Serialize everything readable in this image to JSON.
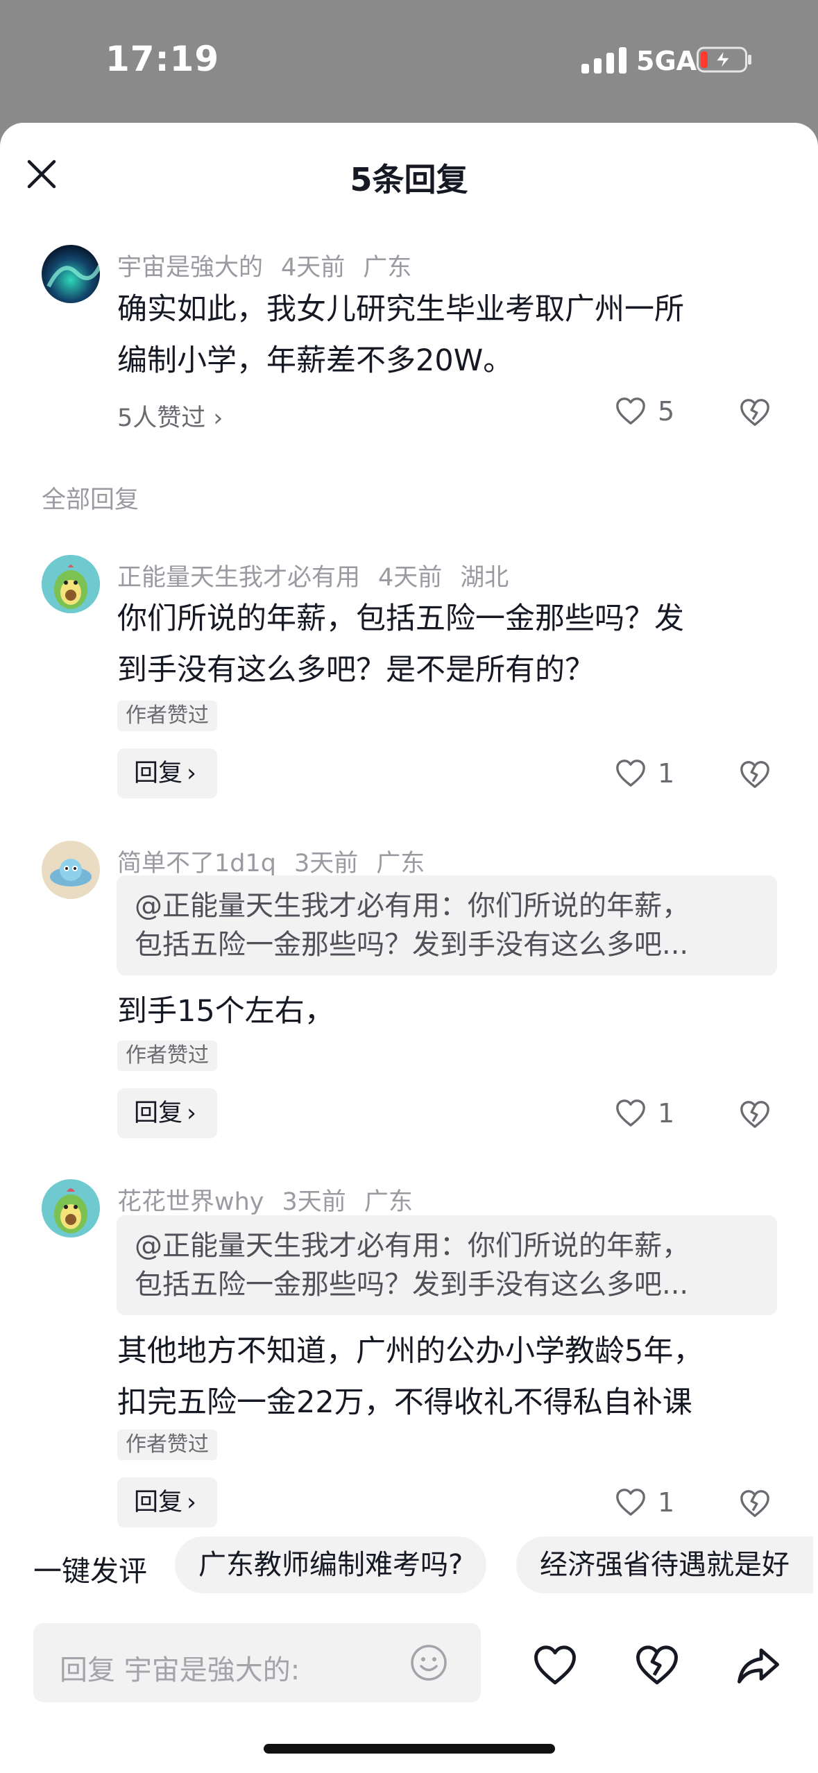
{
  "status_bar": {
    "time": "17:19",
    "network": "5GA"
  },
  "header": {
    "title": "5条回复"
  },
  "main_comment": {
    "author": "宇宙是強大的",
    "time": "4天前",
    "location": "广东",
    "lines": [
      "确实如此，我女儿研究生毕业考取广州一所",
      "编制小学，年薪差不多20W。"
    ],
    "likes_summary": "5人赞过 ›",
    "like_count": "5"
  },
  "section_label": "全部回复",
  "replies": [
    {
      "author": "正能量天生我才必有用",
      "time": "4天前",
      "location": "湖北",
      "lines": [
        "你们所说的年薪，包括五险一金那些吗？发",
        "到手没有这么多吧？是不是所有的？"
      ],
      "tag": "作者赞过",
      "reply_label": "回复",
      "like_count": "1"
    },
    {
      "author": "简单不了1d1q",
      "time": "3天前",
      "location": "广东",
      "quote": [
        "@正能量天生我才必有用：你们所说的年薪，",
        "包括五险一金那些吗？发到手没有这么多吧..."
      ],
      "lines": [
        "到手15个左右，"
      ],
      "tag": "作者赞过",
      "reply_label": "回复",
      "like_count": "1"
    },
    {
      "author": "花花世界why",
      "time": "3天前",
      "location": "广东",
      "quote": [
        "@正能量天生我才必有用：你们所说的年薪，",
        "包括五险一金那些吗？发到手没有这么多吧..."
      ],
      "lines": [
        "其他地方不知道，广州的公办小学教龄5年，",
        "扣完五险一金22万，不得收礼不得私自补课"
      ],
      "tag": "作者赞过",
      "reply_label": "回复",
      "like_count": "1"
    }
  ],
  "quick_comment": {
    "label": "一键发评",
    "chips": [
      "广东教师编制难考吗?",
      "经济强省待遇就是好"
    ]
  },
  "input": {
    "placeholder": "回复 宇宙是強大的:"
  },
  "icons": [
    "close-icon",
    "heart-icon",
    "broken-heart-icon",
    "smiley-icon",
    "share-icon"
  ]
}
